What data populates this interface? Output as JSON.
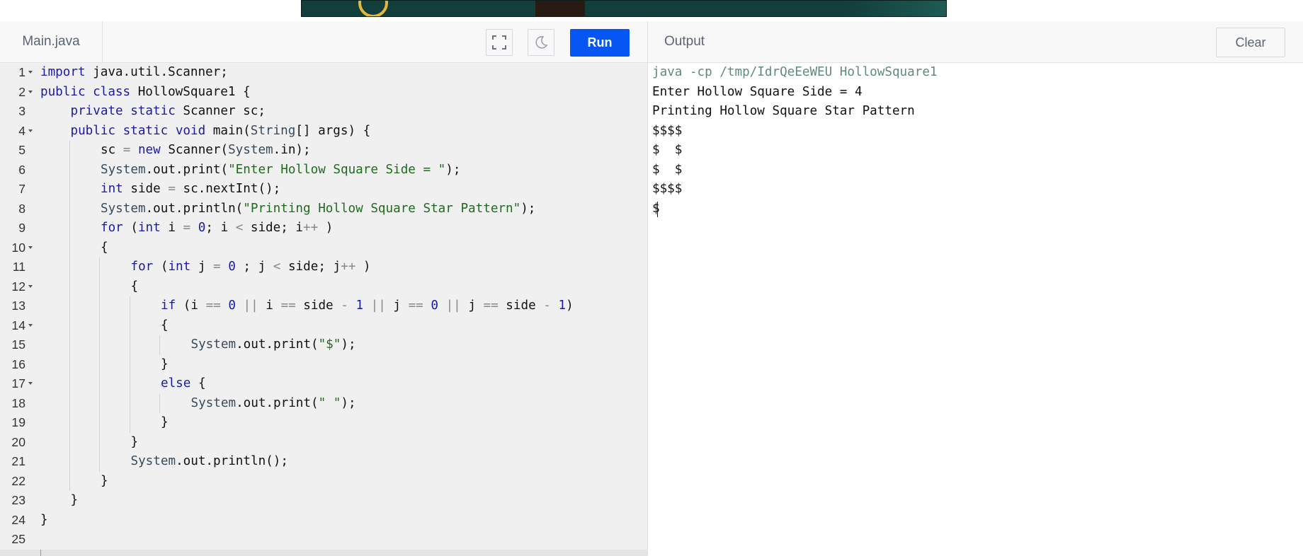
{
  "editor": {
    "file_tab": "Main.java",
    "run_label": "Run",
    "lines": [
      {
        "n": "1",
        "fold": true,
        "indent": 0,
        "tokens": [
          [
            "kw",
            "import"
          ],
          [
            "t",
            " java.util.Scanner;"
          ]
        ]
      },
      {
        "n": "2",
        "fold": true,
        "indent": 0,
        "tokens": [
          [
            "kw",
            "public"
          ],
          [
            "t",
            " "
          ],
          [
            "kw",
            "class"
          ],
          [
            "t",
            " HollowSquare1 {"
          ]
        ]
      },
      {
        "n": "3",
        "fold": false,
        "indent": 1,
        "tokens": [
          [
            "kw",
            "private"
          ],
          [
            "t",
            " "
          ],
          [
            "kw",
            "static"
          ],
          [
            "t",
            " Scanner sc;"
          ]
        ]
      },
      {
        "n": "4",
        "fold": true,
        "indent": 1,
        "tokens": [
          [
            "kw",
            "public"
          ],
          [
            "t",
            " "
          ],
          [
            "kw",
            "static"
          ],
          [
            "t",
            " "
          ],
          [
            "kw",
            "void"
          ],
          [
            "t",
            " main("
          ],
          [
            "cls",
            "String"
          ],
          [
            "t",
            "[] args) {"
          ]
        ]
      },
      {
        "n": "5",
        "fold": false,
        "indent": 2,
        "tokens": [
          [
            "t",
            "sc "
          ],
          [
            "op",
            "="
          ],
          [
            "t",
            " "
          ],
          [
            "kw",
            "new"
          ],
          [
            "t",
            " Scanner("
          ],
          [
            "cls",
            "System"
          ],
          [
            "t",
            ".in);"
          ]
        ]
      },
      {
        "n": "6",
        "fold": false,
        "indent": 2,
        "tokens": [
          [
            "cls",
            "System"
          ],
          [
            "t",
            ".out.print("
          ],
          [
            "str",
            "\"Enter Hollow Square Side = \""
          ],
          [
            "t",
            ");"
          ]
        ]
      },
      {
        "n": "7",
        "fold": false,
        "indent": 2,
        "tokens": [
          [
            "kw",
            "int"
          ],
          [
            "t",
            " side "
          ],
          [
            "op",
            "="
          ],
          [
            "t",
            " sc.nextInt();"
          ]
        ]
      },
      {
        "n": "8",
        "fold": false,
        "indent": 2,
        "tokens": [
          [
            "cls",
            "System"
          ],
          [
            "t",
            ".out.println("
          ],
          [
            "str",
            "\"Printing Hollow Square Star Pattern\""
          ],
          [
            "t",
            ");"
          ]
        ]
      },
      {
        "n": "9",
        "fold": false,
        "indent": 2,
        "tokens": [
          [
            "kw",
            "for"
          ],
          [
            "t",
            " ("
          ],
          [
            "kw",
            "int"
          ],
          [
            "t",
            " i "
          ],
          [
            "op",
            "="
          ],
          [
            "t",
            " "
          ],
          [
            "num",
            "0"
          ],
          [
            "t",
            "; i "
          ],
          [
            "op",
            "<"
          ],
          [
            "t",
            " side; i"
          ],
          [
            "op",
            "++"
          ],
          [
            "t",
            " )"
          ]
        ]
      },
      {
        "n": "10",
        "fold": true,
        "indent": 2,
        "tokens": [
          [
            "t",
            "{"
          ]
        ]
      },
      {
        "n": "11",
        "fold": false,
        "indent": 3,
        "tokens": [
          [
            "kw",
            "for"
          ],
          [
            "t",
            " ("
          ],
          [
            "kw",
            "int"
          ],
          [
            "t",
            " j "
          ],
          [
            "op",
            "="
          ],
          [
            "t",
            " "
          ],
          [
            "num",
            "0"
          ],
          [
            "t",
            " ; j "
          ],
          [
            "op",
            "<"
          ],
          [
            "t",
            " side; j"
          ],
          [
            "op",
            "++"
          ],
          [
            "t",
            " )"
          ]
        ]
      },
      {
        "n": "12",
        "fold": true,
        "indent": 3,
        "tokens": [
          [
            "t",
            "{"
          ]
        ]
      },
      {
        "n": "13",
        "fold": false,
        "indent": 4,
        "tokens": [
          [
            "kw",
            "if"
          ],
          [
            "t",
            " (i "
          ],
          [
            "op",
            "=="
          ],
          [
            "t",
            " "
          ],
          [
            "num",
            "0"
          ],
          [
            "t",
            " "
          ],
          [
            "op",
            "||"
          ],
          [
            "t",
            " i "
          ],
          [
            "op",
            "=="
          ],
          [
            "t",
            " side "
          ],
          [
            "op",
            "-"
          ],
          [
            "t",
            " "
          ],
          [
            "num",
            "1"
          ],
          [
            "t",
            " "
          ],
          [
            "op",
            "||"
          ],
          [
            "t",
            " j "
          ],
          [
            "op",
            "=="
          ],
          [
            "t",
            " "
          ],
          [
            "num",
            "0"
          ],
          [
            "t",
            " "
          ],
          [
            "op",
            "||"
          ],
          [
            "t",
            " j "
          ],
          [
            "op",
            "=="
          ],
          [
            "t",
            " side "
          ],
          [
            "op",
            "-"
          ],
          [
            "t",
            " "
          ],
          [
            "num",
            "1"
          ],
          [
            "t",
            ")"
          ]
        ]
      },
      {
        "n": "14",
        "fold": true,
        "indent": 4,
        "tokens": [
          [
            "t",
            "{"
          ]
        ]
      },
      {
        "n": "15",
        "fold": false,
        "indent": 5,
        "tokens": [
          [
            "cls",
            "System"
          ],
          [
            "t",
            ".out.print("
          ],
          [
            "str",
            "\"$\""
          ],
          [
            "t",
            ");"
          ]
        ]
      },
      {
        "n": "16",
        "fold": false,
        "indent": 4,
        "tokens": [
          [
            "t",
            "}"
          ]
        ]
      },
      {
        "n": "17",
        "fold": true,
        "indent": 4,
        "tokens": [
          [
            "kw",
            "else"
          ],
          [
            "t",
            " {"
          ]
        ]
      },
      {
        "n": "18",
        "fold": false,
        "indent": 5,
        "tokens": [
          [
            "cls",
            "System"
          ],
          [
            "t",
            ".out.print("
          ],
          [
            "str",
            "\" \""
          ],
          [
            "t",
            ");"
          ]
        ]
      },
      {
        "n": "19",
        "fold": false,
        "indent": 4,
        "tokens": [
          [
            "t",
            "}"
          ]
        ]
      },
      {
        "n": "20",
        "fold": false,
        "indent": 3,
        "tokens": [
          [
            "t",
            "}"
          ]
        ]
      },
      {
        "n": "21",
        "fold": false,
        "indent": 3,
        "tokens": [
          [
            "cls",
            "System"
          ],
          [
            "t",
            ".out.println();"
          ]
        ]
      },
      {
        "n": "22",
        "fold": false,
        "indent": 2,
        "tokens": [
          [
            "t",
            "}"
          ]
        ]
      },
      {
        "n": "23",
        "fold": false,
        "indent": 1,
        "tokens": [
          [
            "t",
            "}"
          ]
        ]
      },
      {
        "n": "24",
        "fold": false,
        "indent": 0,
        "tokens": [
          [
            "t",
            "}"
          ]
        ]
      },
      {
        "n": "25",
        "fold": false,
        "indent": 0,
        "tokens": []
      }
    ],
    "icons": {
      "fullscreen": "fullscreen-icon",
      "theme": "moon-icon"
    }
  },
  "output": {
    "title": "Output",
    "clear_label": "Clear",
    "command": "java -cp /tmp/IdrQeEeWEU HollowSquare1",
    "lines": [
      "Enter Hollow Square Side = 4",
      "Printing Hollow Square Star Pattern",
      "$$$$",
      "$  $",
      "$  $",
      "$$$$",
      "$"
    ]
  }
}
